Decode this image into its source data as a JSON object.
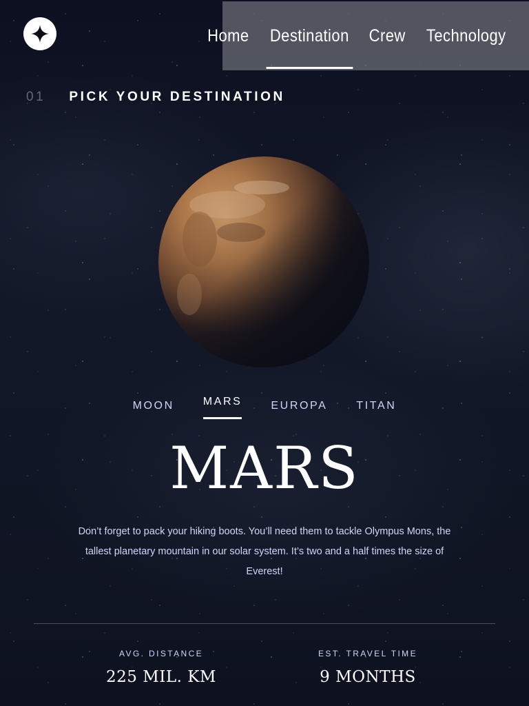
{
  "nav": {
    "items": [
      "Home",
      "Destination",
      "Crew",
      "Technology"
    ],
    "active_index": 1
  },
  "page_heading": {
    "number": "01",
    "title": "PICK YOUR DESTINATION"
  },
  "tabs": {
    "items": [
      "MOON",
      "MARS",
      "EUROPA",
      "TITAN"
    ],
    "active_index": 1
  },
  "destination": {
    "name": "MARS",
    "description": "Don’t forget to pack your hiking boots. You’ll need them to tackle Olympus Mons, the tallest planetary mountain in our solar system. It’s two and a half times the size of Everest!",
    "stats": {
      "distance_label": "AVG. DISTANCE",
      "distance_value": "225 MIL. KM",
      "travel_label": "EST. TRAVEL TIME",
      "travel_value": "9 MONTHS"
    }
  },
  "icons": {
    "logo": "star-logo-icon",
    "planet": "mars-planet-image"
  },
  "colors": {
    "background": "#0b0d17",
    "accent": "#ffffff",
    "muted_text": "#d0d6f9"
  }
}
